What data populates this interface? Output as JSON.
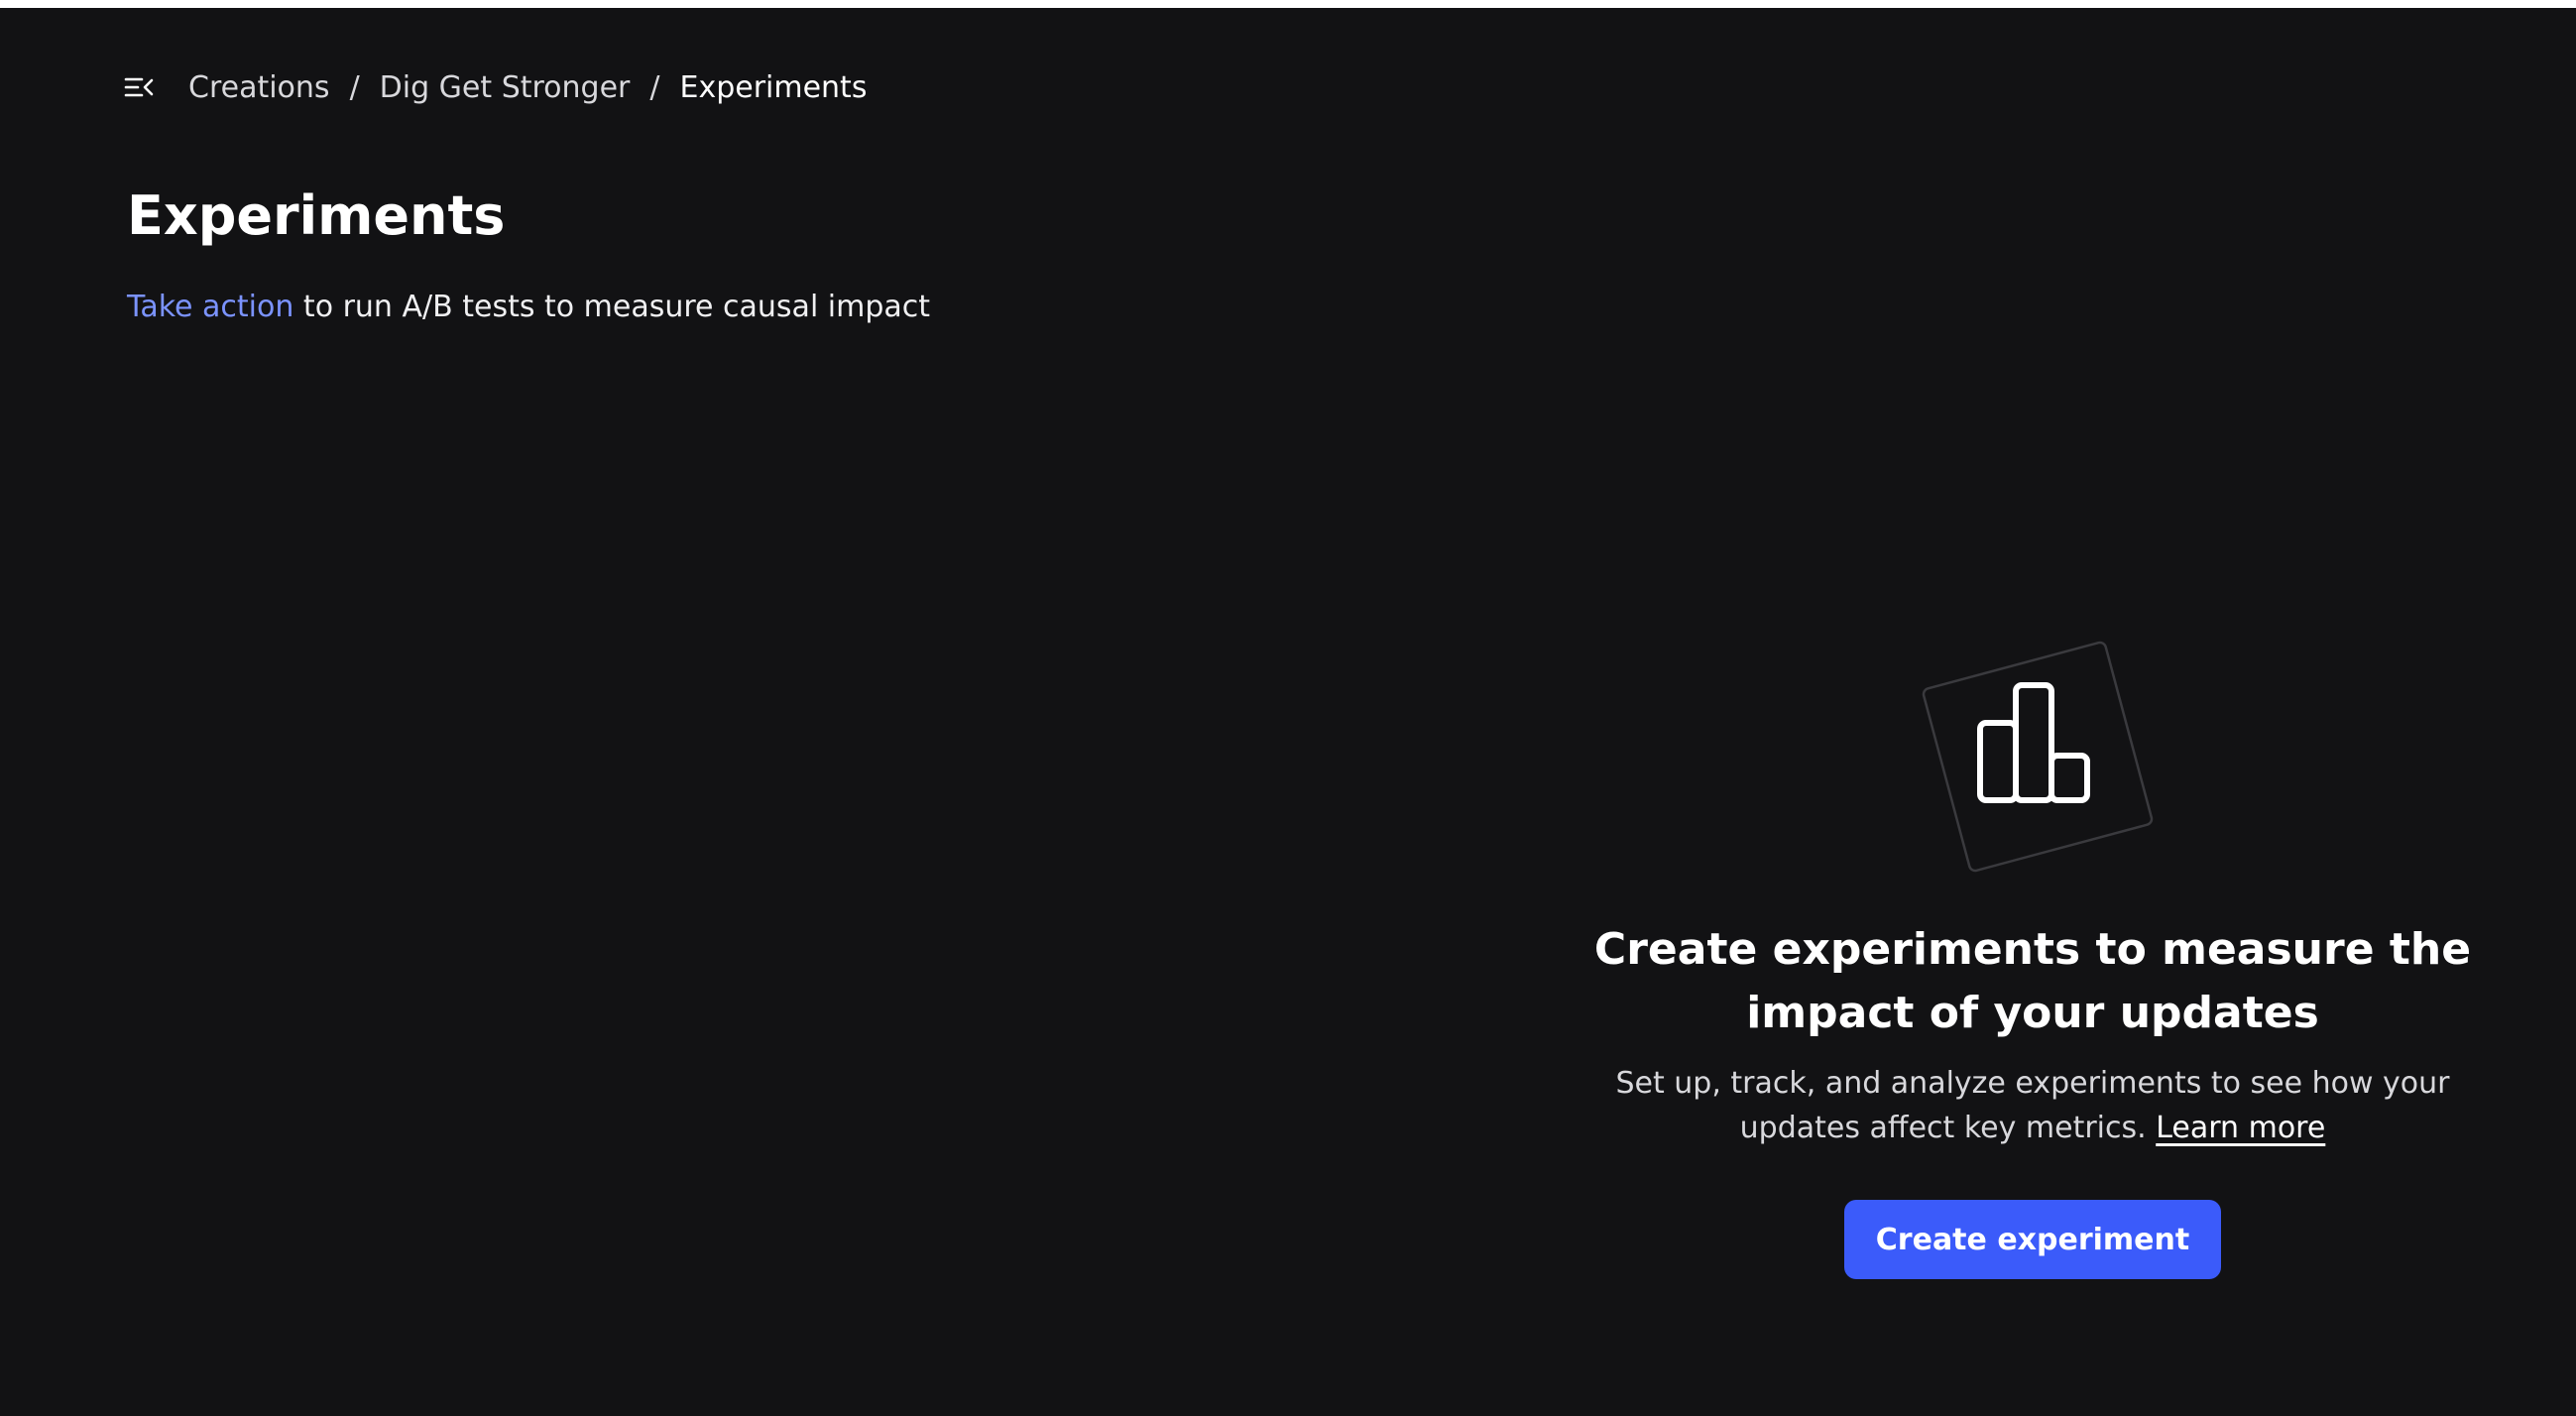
{
  "header": {
    "menu_icon": "collapse-menu-icon",
    "breadcrumb": [
      {
        "label": "Creations"
      },
      {
        "label": "Dig Get Stronger"
      },
      {
        "label": "Experiments"
      }
    ],
    "separator": "/"
  },
  "main": {
    "title": "Experiments",
    "subtitle_link": "Take action",
    "subtitle_rest": " to run A/B tests to measure causal impact"
  },
  "empty_state": {
    "icon": "bar-chart-icon",
    "title": "Create experiments to measure the impact of your updates",
    "description": "Set up, track, and analyze experiments to see how your updates affect key metrics.",
    "learn_more": "Learn more",
    "button_label": "Create experiment"
  },
  "colors": {
    "background": "#121214",
    "accent": "#3b5bfa",
    "link": "#7b93ff"
  }
}
